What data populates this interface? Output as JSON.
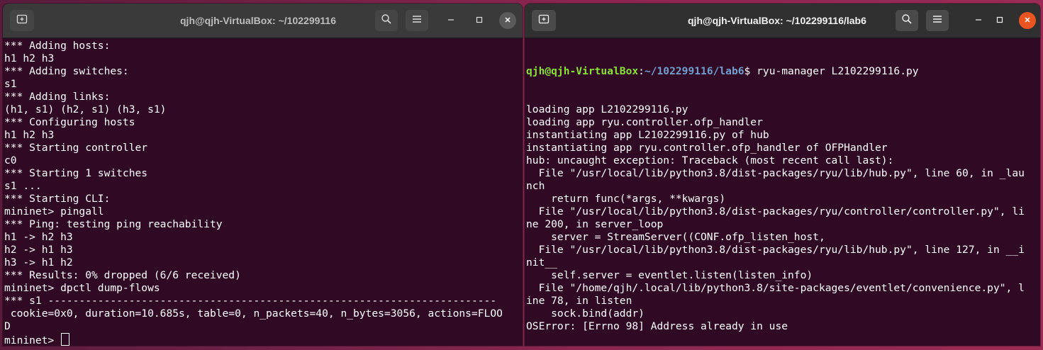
{
  "colors": {
    "terminal_bg": "#300a24",
    "prompt_user": "#8ae234",
    "prompt_path": "#729fcf",
    "close_active": "#e95420"
  },
  "left_window": {
    "title": "qjh@qjh-VirtualBox: ~/102299116",
    "icons": {
      "new_tab": "new-tab-icon",
      "search": "search-icon",
      "menu": "hamburger-menu-icon",
      "minimize": "minimize-icon",
      "maximize": "maximize-icon",
      "close": "close-icon"
    },
    "lines": [
      "*** Adding hosts:",
      "h1 h2 h3",
      "*** Adding switches:",
      "s1",
      "*** Adding links:",
      "(h1, s1) (h2, s1) (h3, s1)",
      "*** Configuring hosts",
      "h1 h2 h3",
      "*** Starting controller",
      "c0",
      "*** Starting 1 switches",
      "s1 ...",
      "*** Starting CLI:",
      "mininet> pingall",
      "*** Ping: testing ping reachability",
      "h1 -> h2 h3",
      "h2 -> h1 h3",
      "h3 -> h1 h2",
      "*** Results: 0% dropped (6/6 received)",
      "mininet> dpctl dump-flows",
      "*** s1 ------------------------------------------------------------------------",
      " cookie=0x0, duration=10.685s, table=0, n_packets=40, n_bytes=3056, actions=FLOO",
      "D"
    ],
    "current_prompt": "mininet> "
  },
  "right_window": {
    "title": "qjh@qjh-VirtualBox: ~/102299116/lab6",
    "prompt": {
      "user_host": "qjh@qjh-VirtualBox",
      "separator": ":",
      "path": "~/102299116/lab6",
      "symbol": "$ ",
      "command": "ryu-manager L2102299116.py"
    },
    "lines": [
      "loading app L2102299116.py",
      "loading app ryu.controller.ofp_handler",
      "instantiating app L2102299116.py of hub",
      "instantiating app ryu.controller.ofp_handler of OFPHandler",
      "hub: uncaught exception: Traceback (most recent call last):",
      "  File \"/usr/local/lib/python3.8/dist-packages/ryu/lib/hub.py\", line 60, in _lau",
      "nch",
      "    return func(*args, **kwargs)",
      "  File \"/usr/local/lib/python3.8/dist-packages/ryu/controller/controller.py\", li",
      "ne 200, in server_loop",
      "    server = StreamServer((CONF.ofp_listen_host,",
      "  File \"/usr/local/lib/python3.8/dist-packages/ryu/lib/hub.py\", line 127, in __i",
      "nit__",
      "    self.server = eventlet.listen(listen_info)",
      "  File \"/home/qjh/.local/lib/python3.8/site-packages/eventlet/convenience.py\", l",
      "ine 78, in listen",
      "    sock.bind(addr)",
      "OSError: [Errno 98] Address already in use"
    ]
  }
}
